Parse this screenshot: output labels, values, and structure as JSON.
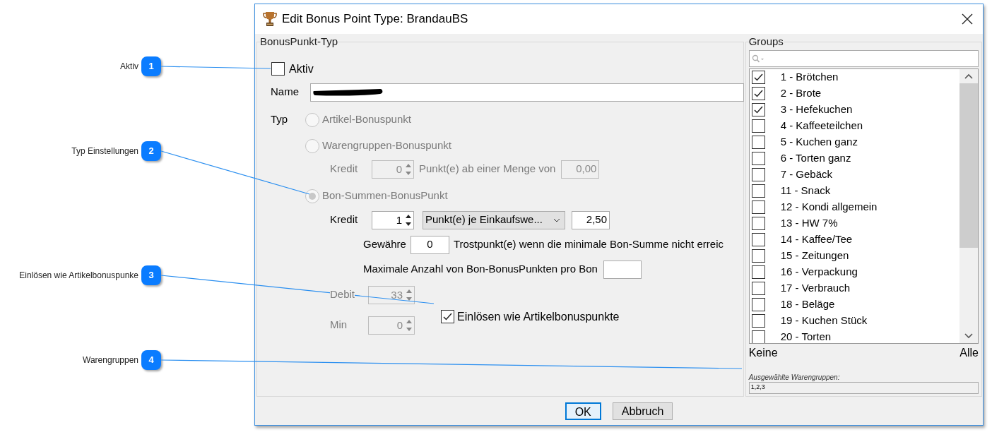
{
  "window": {
    "title": "Edit Bonus Point Type: BrandauBS"
  },
  "callouts": [
    {
      "number": "1",
      "label": "Aktiv"
    },
    {
      "number": "2",
      "label": "Typ Einstellungen"
    },
    {
      "number": "3",
      "label": "Einlösen wie Artikelbonuspunke"
    },
    {
      "number": "4",
      "label": "Warengruppen"
    }
  ],
  "bonus_type": {
    "legend": "BonusPunkt-Typ",
    "aktiv": {
      "label": "Aktiv",
      "checked": false
    },
    "name": {
      "label": "Name",
      "redacted": true
    },
    "typ_label": "Typ",
    "types": [
      {
        "label": "Artikel-Bonuspunkt",
        "selected": false,
        "disabled": true
      },
      {
        "label": "Warengruppen-Bonuspunkt",
        "selected": false,
        "disabled": true
      },
      {
        "label": "Bon-Summen-BonusPunkt",
        "selected": true,
        "disabled": true
      }
    ],
    "warengruppen_options": {
      "kredit_label": "Kredit",
      "kredit_value": "0",
      "menge_label": "Punkt(e) ab einer Menge von",
      "menge_value": "0,00",
      "disabled": true
    },
    "bon_summen_options": {
      "kredit_label": "Kredit",
      "kredit_value": "1",
      "mode": "Punkt(e) je Einkaufswe...",
      "amount": "2,50",
      "gewaehre_label": "Gewähre",
      "gewaehre_value": "0",
      "trost_label": "Trostpunkt(e) wenn die minimale Bon-Summe nicht erreic",
      "max_label": "Maximale Anzahl von Bon-BonusPunkten pro Bon"
    },
    "debit": {
      "label": "Debit",
      "value": "33",
      "disabled": true
    },
    "einloesen": {
      "label": "Einlösen wie Artikelbonuspunkte",
      "checked": true
    },
    "min": {
      "label": "Min",
      "value": "0",
      "disabled": true
    }
  },
  "groups": {
    "legend": "Groups",
    "items": [
      {
        "label": "1 - Brötchen",
        "checked": true
      },
      {
        "label": "2 - Brote",
        "checked": true
      },
      {
        "label": "3 - Hefekuchen",
        "checked": true
      },
      {
        "label": "4 - Kaffeeteilchen",
        "checked": false
      },
      {
        "label": "5 - Kuchen ganz",
        "checked": false
      },
      {
        "label": "6 - Torten ganz",
        "checked": false
      },
      {
        "label": "7 - Gebäck",
        "checked": false
      },
      {
        "label": "11 - Snack",
        "checked": false
      },
      {
        "label": "12 - Kondi allgemein",
        "checked": false
      },
      {
        "label": "13 - HW 7%",
        "checked": false
      },
      {
        "label": "14 - Kaffee/Tee",
        "checked": false
      },
      {
        "label": "15 - Zeitungen",
        "checked": false
      },
      {
        "label": "16 - Verpackung",
        "checked": false
      },
      {
        "label": "17 - Verbrauch",
        "checked": false
      },
      {
        "label": "18 - Beläge",
        "checked": false
      },
      {
        "label": "19 - Kuchen Stück",
        "checked": false
      },
      {
        "label": "20 - Torten",
        "checked": false
      }
    ],
    "none_link": "Keine",
    "all_link": "Alle",
    "selected_label": "Ausgewählte Warengruppen:",
    "selected_value": "1,2,3"
  },
  "buttons": [
    {
      "label": "OK",
      "default": true
    },
    {
      "label": "Abbruch",
      "default": false
    }
  ]
}
